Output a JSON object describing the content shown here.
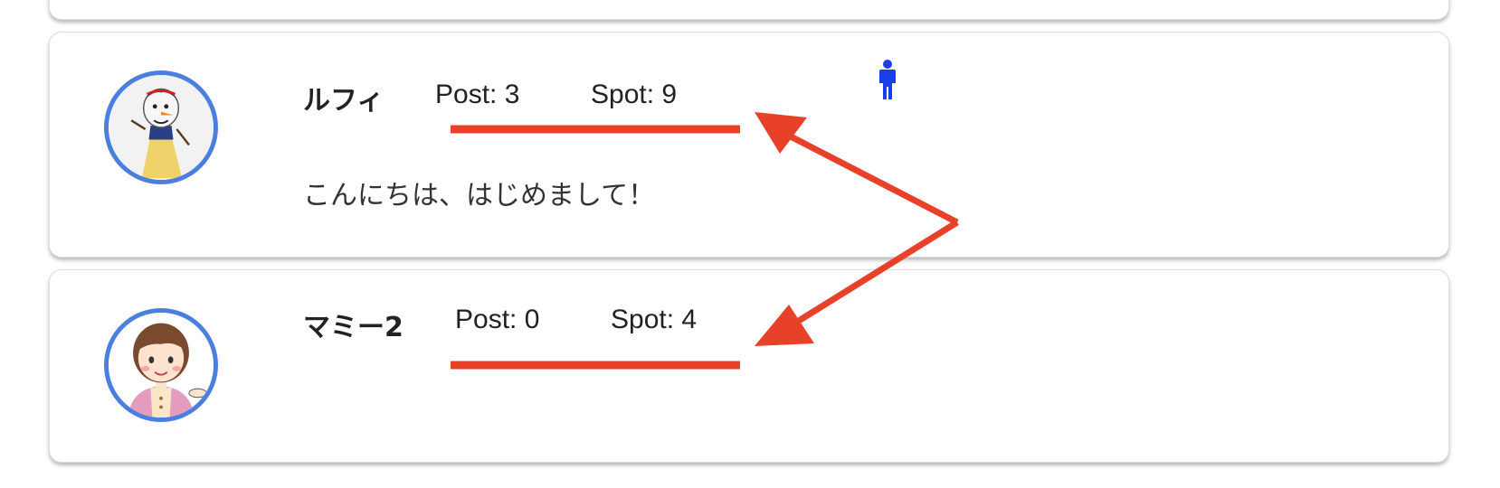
{
  "users": [
    {
      "name": "ルフィ",
      "post_label": "Post: 3",
      "spot_label": "Spot: 9",
      "bio": "こんにちは、はじめまして！",
      "gender_icon": "person-male-icon",
      "avatar_icon": "snowman-in-dress-avatar"
    },
    {
      "name": "マミー2",
      "post_label": "Post: 0",
      "spot_label": "Spot: 4",
      "bio": "",
      "avatar_icon": "woman-cartoon-avatar"
    }
  ],
  "annotation": {
    "color": "#e8412a",
    "type": "red-underlines-and-arrows"
  },
  "colors": {
    "avatar_border": "#4a7fe0",
    "gender_icon": "#1a3ee8"
  }
}
